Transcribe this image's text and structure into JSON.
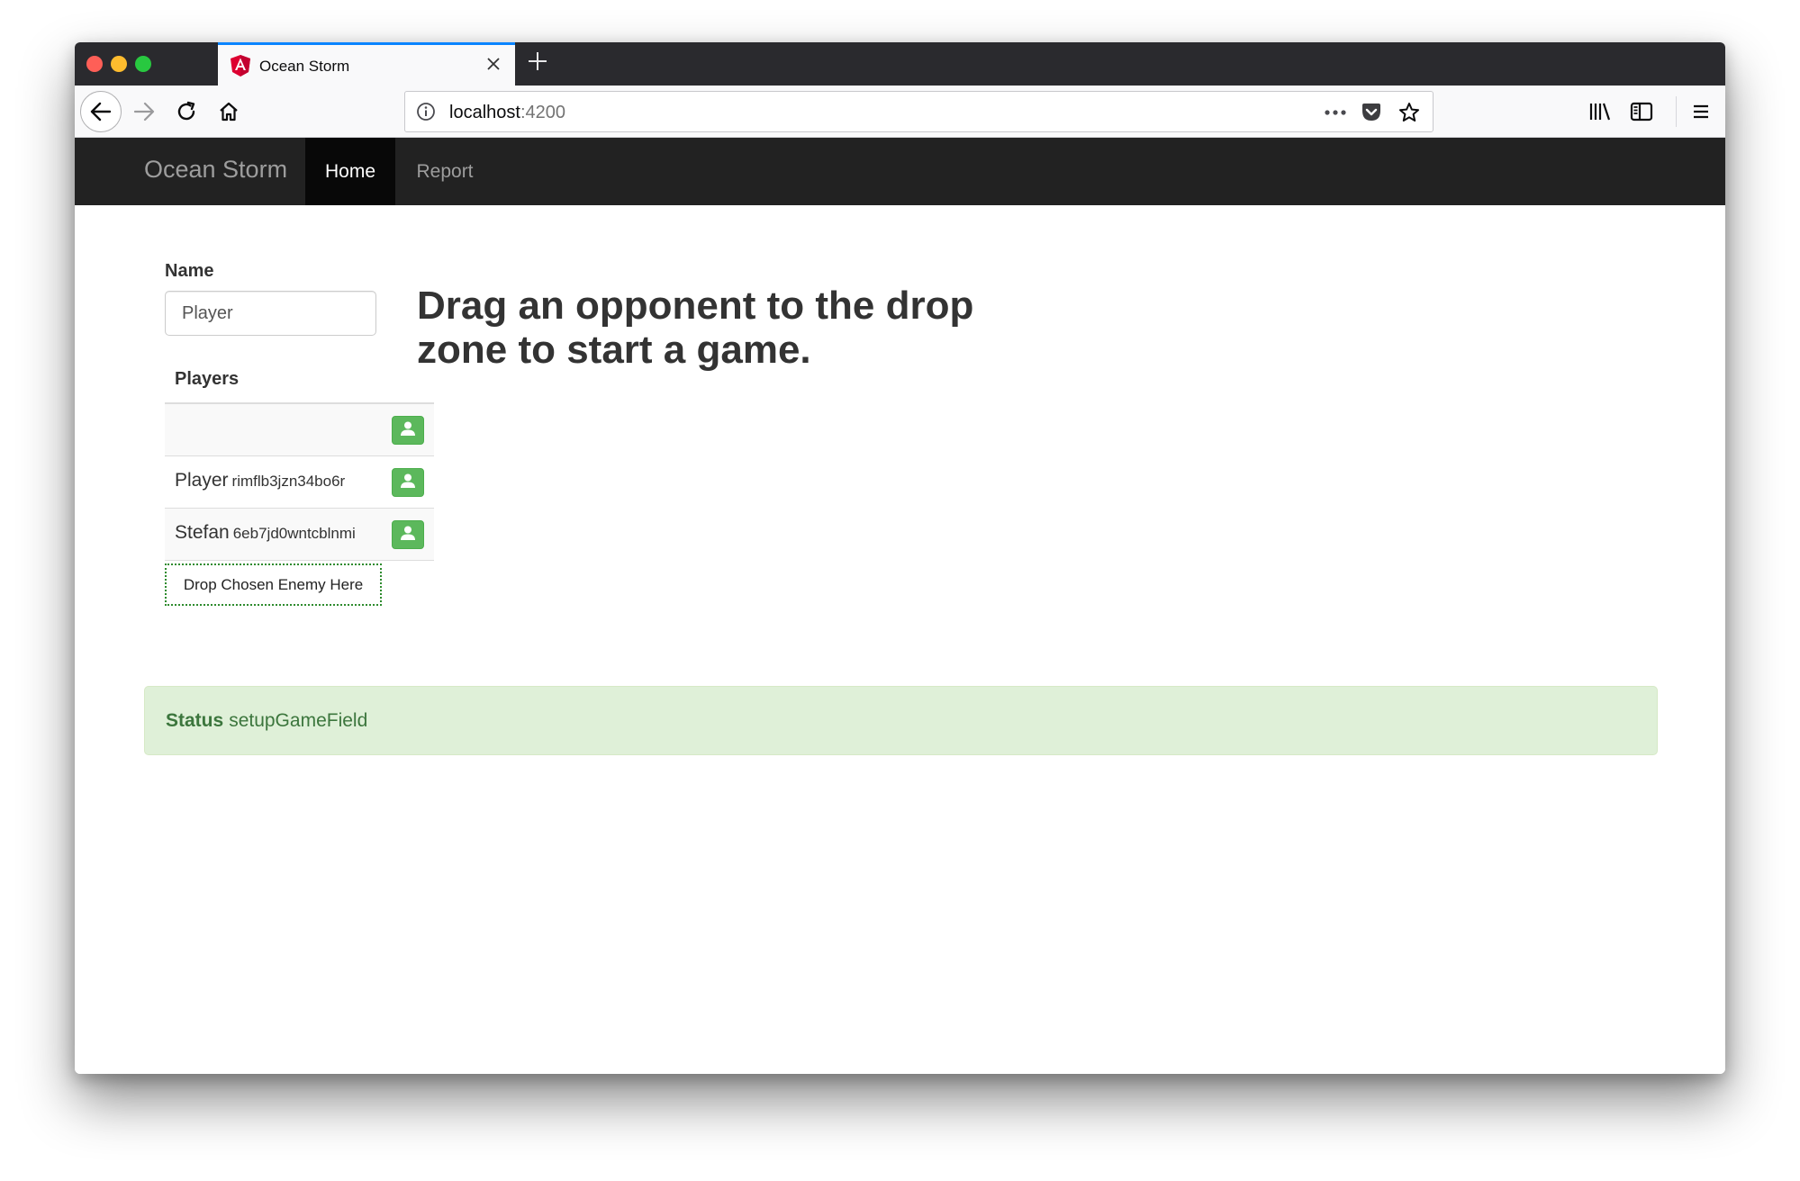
{
  "browser": {
    "tab_title": "Ocean Storm",
    "url_host": "localhost",
    "url_port": ":4200",
    "icons": {
      "tab_favicon": "angular-icon",
      "tab_close": "close-icon",
      "new_tab": "plus-icon",
      "back": "back-arrow-icon",
      "forward": "forward-arrow-icon",
      "reload": "reload-icon",
      "home": "home-icon",
      "info": "info-icon",
      "page_actions": "more-dots-icon",
      "pocket": "pocket-icon",
      "bookmark": "star-icon",
      "library": "library-icon",
      "sidebar": "sidebar-icon",
      "menu": "hamburger-menu-icon"
    }
  },
  "navbar": {
    "brand": "Ocean Storm",
    "items": [
      {
        "label": "Home",
        "active": true
      },
      {
        "label": "Report",
        "active": false
      }
    ]
  },
  "form": {
    "name_label": "Name",
    "name_value": "Player"
  },
  "players": {
    "title": "Players",
    "rows": [
      {
        "name": "",
        "id": "",
        "button_icon": "user-icon"
      },
      {
        "name": "Player",
        "id": "rimflb3jzn34bo6r",
        "button_icon": "user-icon"
      },
      {
        "name": "Stefan",
        "id": "6eb7jd0wntcblnmi",
        "button_icon": "user-icon"
      }
    ],
    "drop_zone_label": "Drop Chosen Enemy Here"
  },
  "heading": "Drag an opponent to the drop zone to start a game.",
  "status": {
    "label": "Status",
    "value": "setupGameField"
  },
  "colors": {
    "navbar_bg": "#222222",
    "success_button": "#5cb85c",
    "alert_bg": "#dff0d8",
    "alert_text": "#3c763d",
    "tab_accent": "#0a84ff"
  }
}
